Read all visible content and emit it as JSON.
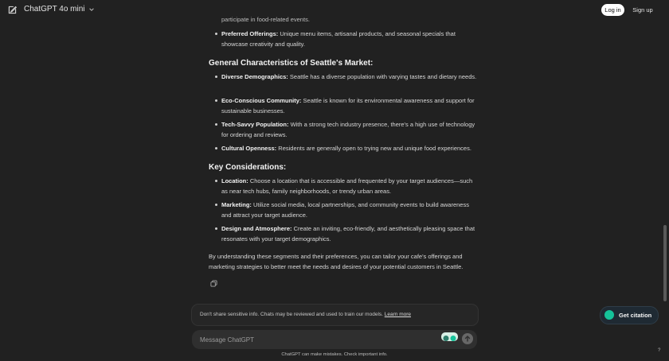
{
  "header": {
    "model_name": "ChatGPT 4o mini",
    "login_label": "Log in",
    "signup_label": "Sign up"
  },
  "content": {
    "partial_top_line": "participate in food-related events.",
    "preferred_offerings": {
      "label": "Preferred Offerings:",
      "text": "Unique menu items, artisanal products, and seasonal specials that showcase creativity and quality."
    },
    "section_general": "General Characteristics of Seattle's Market:",
    "general_items": [
      {
        "label": "Diverse Demographics:",
        "text": "Seattle has a diverse population with varying tastes and dietary needs."
      },
      {
        "label": "Eco-Conscious Community:",
        "text": "Seattle is known for its environmental awareness and support for sustainable businesses."
      },
      {
        "label": "Tech-Savvy Population:",
        "text": "With a strong tech industry presence, there's a high use of technology for ordering and reviews."
      },
      {
        "label": "Cultural Openness:",
        "text": "Residents are generally open to trying new and unique food experiences."
      }
    ],
    "section_key": "Key Considerations:",
    "key_items": [
      {
        "label": "Location:",
        "text": "Choose a location that is accessible and frequented by your target audiences—such as near tech hubs, family neighborhoods, or trendy urban areas."
      },
      {
        "label": "Marketing:",
        "text": "Utilize social media, local partnerships, and community events to build awareness and attract your target audience."
      },
      {
        "label": "Design and Atmosphere:",
        "text": "Create an inviting, eco-friendly, and aesthetically pleasing space that resonates with your target demographics."
      }
    ],
    "closing_paragraph": "By understanding these segments and their preferences, you can tailor your cafe's offerings and marketing strategies to better meet the needs and desires of your potential customers in Seattle."
  },
  "disclaimer": {
    "text": "Don't share sensitive info. Chats may be reviewed and used to train our models.",
    "link": "Learn more"
  },
  "composer": {
    "placeholder": "Message ChatGPT"
  },
  "footer_note": "ChatGPT can make mistakes. Check important info.",
  "citation_button": "Get citation",
  "help_label": "?",
  "colors": {
    "background": "#212121",
    "composer": "#2f2f2f",
    "grammarly_green": "#15c39a"
  }
}
